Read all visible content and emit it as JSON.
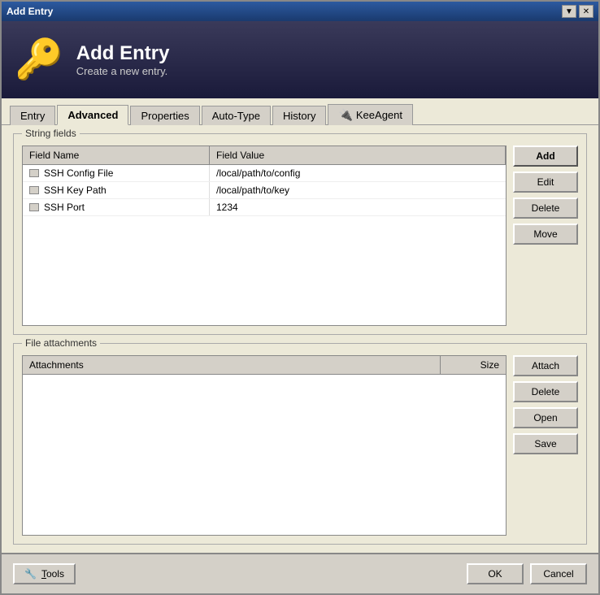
{
  "window": {
    "title": "Add Entry",
    "controls": {
      "minimize": "▼",
      "close": "✕"
    }
  },
  "header": {
    "icon": "🔑",
    "title": "Add Entry",
    "subtitle": "Create a new entry."
  },
  "tabs": [
    {
      "id": "entry",
      "label": "Entry",
      "active": false
    },
    {
      "id": "advanced",
      "label": "Advanced",
      "active": true
    },
    {
      "id": "properties",
      "label": "Properties",
      "active": false
    },
    {
      "id": "auto-type",
      "label": "Auto-Type",
      "active": false
    },
    {
      "id": "history",
      "label": "History",
      "active": false
    },
    {
      "id": "keeagent",
      "label": "KeeAgent",
      "active": false,
      "has_icon": true
    }
  ],
  "string_fields": {
    "group_label": "String fields",
    "columns": [
      {
        "id": "field-name",
        "label": "Field Name"
      },
      {
        "id": "field-value",
        "label": "Field Value"
      }
    ],
    "rows": [
      {
        "name": "SSH Config File",
        "value": "/local/path/to/config"
      },
      {
        "name": "SSH Key Path",
        "value": "/local/path/to/key"
      },
      {
        "name": "SSH Port",
        "value": "1234"
      }
    ],
    "buttons": [
      {
        "id": "add",
        "label": "Add",
        "primary": true
      },
      {
        "id": "edit",
        "label": "Edit"
      },
      {
        "id": "delete",
        "label": "Delete"
      },
      {
        "id": "move",
        "label": "Move"
      }
    ]
  },
  "file_attachments": {
    "group_label": "File attachments",
    "columns": [
      {
        "id": "attachments",
        "label": "Attachments"
      },
      {
        "id": "size",
        "label": "Size"
      }
    ],
    "rows": [],
    "buttons": [
      {
        "id": "attach",
        "label": "Attach"
      },
      {
        "id": "delete",
        "label": "Delete"
      },
      {
        "id": "open",
        "label": "Open"
      },
      {
        "id": "save",
        "label": "Save"
      }
    ]
  },
  "footer": {
    "tools_label": "Tools",
    "tools_icon": "🔧",
    "ok_label": "OK",
    "cancel_label": "Cancel"
  }
}
